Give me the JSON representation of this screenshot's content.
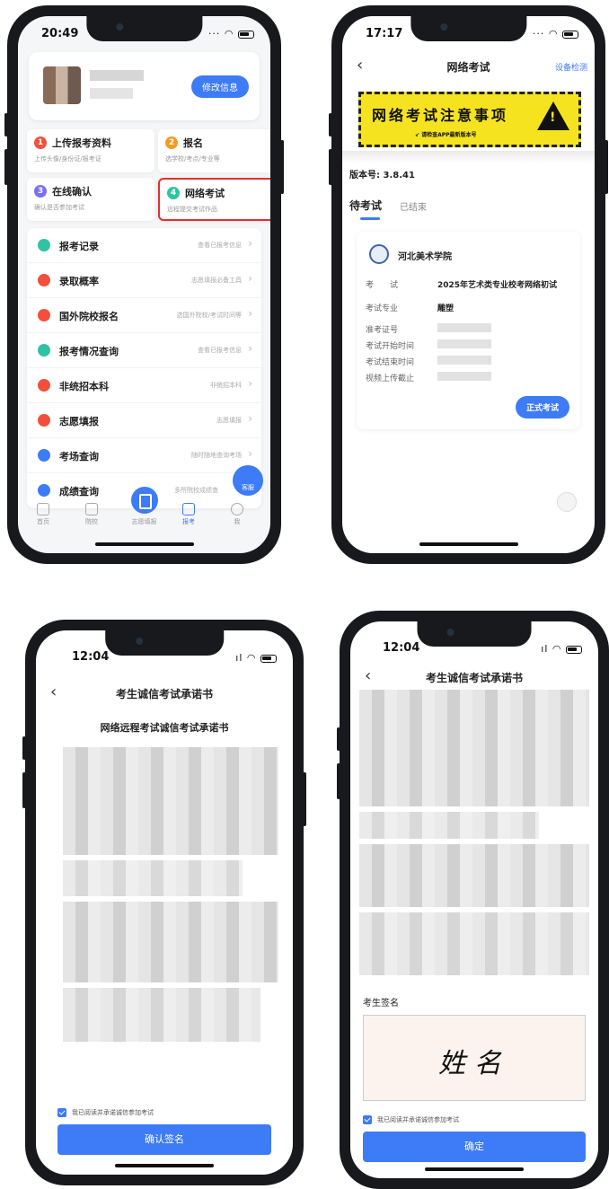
{
  "phone1": {
    "status_time": "20:49",
    "profile": {
      "edit_button": "修改信息"
    },
    "steps": [
      {
        "num": "1",
        "title": "上传报考资料",
        "sub": "上传头像/身份证/报考证",
        "color": "#f2503c"
      },
      {
        "num": "2",
        "title": "报名",
        "sub": "选学校/考点/专业等",
        "color": "#f59a23"
      },
      {
        "num": "3",
        "title": "在线确认",
        "sub": "确认是否参加考试",
        "color": "#7b6ef6"
      },
      {
        "num": "4",
        "title": "网络考试",
        "sub": "远程提交考试作品",
        "color": "#2fc3a3"
      }
    ],
    "menu": [
      {
        "label": "报考记录",
        "hint": "查看已报考信息",
        "color": "#2fc3a3"
      },
      {
        "label": "录取概率",
        "hint": "志愿填报必备工具",
        "color": "#f2503c"
      },
      {
        "label": "国外院校报名",
        "hint": "选国外院校/考试时间等",
        "color": "#f2503c"
      },
      {
        "label": "报考情况查询",
        "hint": "查看已报考信息",
        "color": "#2fc3a3"
      },
      {
        "label": "非统招本科",
        "hint": "非统招本科",
        "color": "#f2503c"
      },
      {
        "label": "志愿填报",
        "hint": "志愿填报",
        "color": "#f2503c"
      },
      {
        "label": "考场查询",
        "hint": "随时随地查询考场",
        "color": "#3d7bf7"
      },
      {
        "label": "成绩查询",
        "hint": "多所院校成绩查",
        "color": "#3d7bf7"
      }
    ],
    "kefu": "客服",
    "tabs": [
      "首页",
      "院校",
      "志愿填报",
      "报考",
      "我"
    ]
  },
  "phone2": {
    "status_time": "17:17",
    "title": "网络考试",
    "right_action": "设备检测",
    "banner_title": "网络考试注意事项",
    "banner_sub": "↙ 请检查APP最新版本号",
    "version": "版本号: 3.8.41",
    "tab_pending": "待考试",
    "tab_done": "已结束",
    "school": "河北美术学院",
    "fields": [
      {
        "key": "考　　试",
        "value": "2025年艺术类专业校考网络初试"
      },
      {
        "key": "考试专业",
        "value": "雕塑"
      },
      {
        "key": "准考证号",
        "value": ""
      },
      {
        "key": "考试开始时间",
        "value": ""
      },
      {
        "key": "考试结束时间",
        "value": ""
      },
      {
        "key": "视频上传截止",
        "value": ""
      }
    ],
    "exam_button": "正式考试"
  },
  "phone3": {
    "status_time": "12:04",
    "title": "考生诚信考试承诺书",
    "doc_title": "网络远程考试诚信考试承诺书",
    "agree_text": "我已阅读并承诺诚信参加考试",
    "button": "确认签名"
  },
  "phone4": {
    "status_time": "12:04",
    "title": "考生诚信考试承诺书",
    "signature_label": "考生签名",
    "signature": "姓名",
    "agree_text": "我已阅读并承诺诚信参加考试",
    "button": "确定"
  }
}
